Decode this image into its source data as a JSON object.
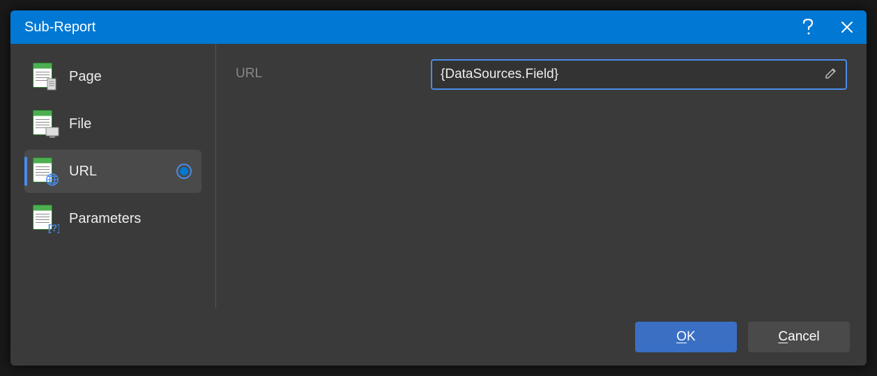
{
  "titlebar": {
    "title": "Sub-Report"
  },
  "sidebar": {
    "items": [
      {
        "label": "Page",
        "selected": false
      },
      {
        "label": "File",
        "selected": false
      },
      {
        "label": "URL",
        "selected": true
      },
      {
        "label": "Parameters",
        "selected": false
      }
    ]
  },
  "content": {
    "url": {
      "label": "URL",
      "value": "{DataSources.Field}"
    }
  },
  "footer": {
    "ok_label": "OK",
    "cancel_label": "Cancel"
  }
}
